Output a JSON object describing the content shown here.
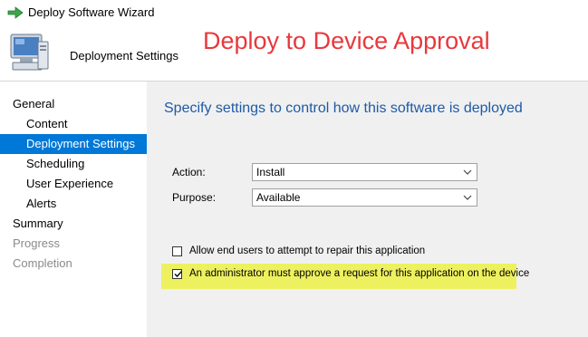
{
  "window": {
    "title": "Deploy Software Wizard",
    "icon": "green-arrow-icon"
  },
  "header": {
    "title": "Deployment Settings",
    "icon": "computer-icon",
    "overlay_text": "Deploy to Device Approval",
    "overlay_color": "#e8383d"
  },
  "sidebar": {
    "items": [
      {
        "label": "General",
        "state": "normal"
      },
      {
        "label": "Content",
        "state": "normal"
      },
      {
        "label": "Deployment Settings",
        "state": "selected"
      },
      {
        "label": "Scheduling",
        "state": "normal"
      },
      {
        "label": "User Experience",
        "state": "normal"
      },
      {
        "label": "Alerts",
        "state": "normal"
      },
      {
        "label": "Summary",
        "state": "normal"
      },
      {
        "label": "Progress",
        "state": "disabled"
      },
      {
        "label": "Completion",
        "state": "disabled"
      }
    ],
    "selected_color": "#0078d7"
  },
  "main": {
    "heading": "Specify settings to control how this software is deployed",
    "heading_color": "#1e5aa8",
    "action": {
      "label": "Action:",
      "value": "Install"
    },
    "purpose": {
      "label": "Purpose:",
      "value": "Available"
    },
    "options": [
      {
        "label": "Allow end users to attempt to repair this application",
        "checked": false
      },
      {
        "label": "An administrator must approve a request for this application on the device",
        "checked": true
      }
    ],
    "highlight_color": "#eef15f"
  }
}
